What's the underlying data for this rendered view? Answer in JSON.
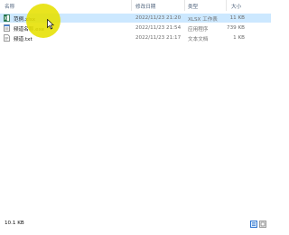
{
  "columns": {
    "name": "名称",
    "date": "修改日期",
    "type": "类型",
    "size": "大小"
  },
  "files": [
    {
      "name": "范例.xlsx",
      "date": "2022/11/23 21:20",
      "type": "XLSX 工作表",
      "size": "11 KB",
      "icon": "excel-file-icon",
      "selected": true
    },
    {
      "name": "频道名称.exe",
      "date": "2022/11/23 21:54",
      "type": "应用程序",
      "size": "739 KB",
      "icon": "exe-file-icon",
      "selected": false
    },
    {
      "name": "频道.txt",
      "date": "2022/11/23 21:17",
      "type": "文本文档",
      "size": "1 KB",
      "icon": "text-file-icon",
      "selected": false
    }
  ],
  "status": {
    "summary": "10.1 KB"
  },
  "colors": {
    "selection": "#cce8ff",
    "header_text": "#4c607a",
    "cursor_highlight": "#e6e000"
  },
  "view_buttons": [
    {
      "icon": "details-view-icon",
      "active": true
    },
    {
      "icon": "large-icons-view-icon",
      "active": false
    }
  ]
}
